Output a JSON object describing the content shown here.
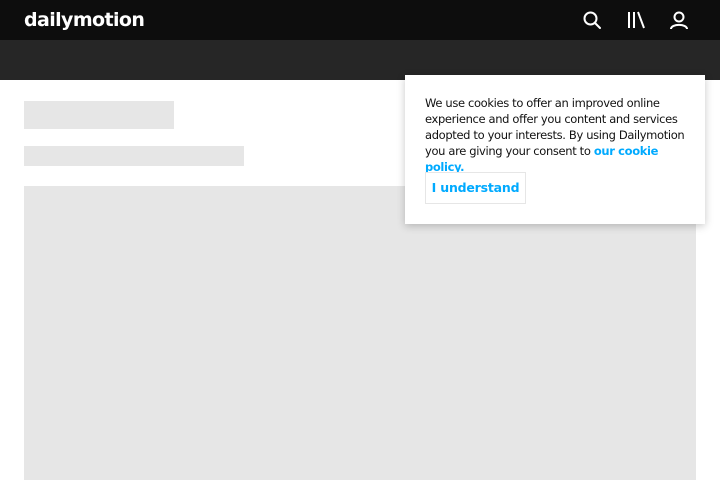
{
  "header": {
    "logo_text": "dailymotion",
    "icons": [
      "search-icon",
      "library-icon",
      "user-icon"
    ]
  },
  "cookie_banner": {
    "message": "We use cookies to offer an improved online experience and offer you content and services adopted to your interests. By using Dailymotion you are giving your consent to ",
    "link_text": "our cookie policy.",
    "button_label": "I understand"
  },
  "colors": {
    "topbar": "#0d0d0d",
    "subbar": "#262626",
    "skeleton": "#e6e6e6",
    "accent": "#00aaff"
  }
}
